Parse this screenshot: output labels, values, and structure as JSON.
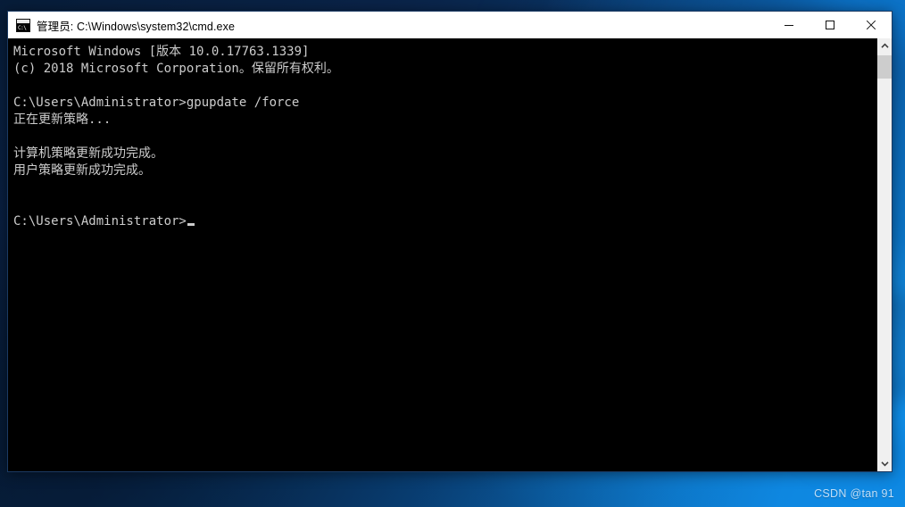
{
  "window": {
    "title": "管理员: C:\\Windows\\system32\\cmd.exe",
    "icon": "cmd-console-icon",
    "controls": {
      "minimize": "最小化",
      "maximize": "最大化",
      "close": "关闭"
    }
  },
  "console": {
    "foreground_color": "#cccccc",
    "background_color": "#000000",
    "lines": [
      "Microsoft Windows [版本 10.0.17763.1339]",
      "(c) 2018 Microsoft Corporation。保留所有权利。",
      "",
      "C:\\Users\\Administrator>gpupdate /force",
      "正在更新策略...",
      "",
      "计算机策略更新成功完成。",
      "用户策略更新成功完成。",
      "",
      ""
    ],
    "prompt": "C:\\Users\\Administrator>",
    "cursor": "_"
  },
  "scrollbar": {
    "up_arrow": "▲",
    "down_arrow": "▼",
    "thumb_label": "scroll-thumb"
  },
  "watermark": {
    "text": "CSDN @tan 91"
  }
}
